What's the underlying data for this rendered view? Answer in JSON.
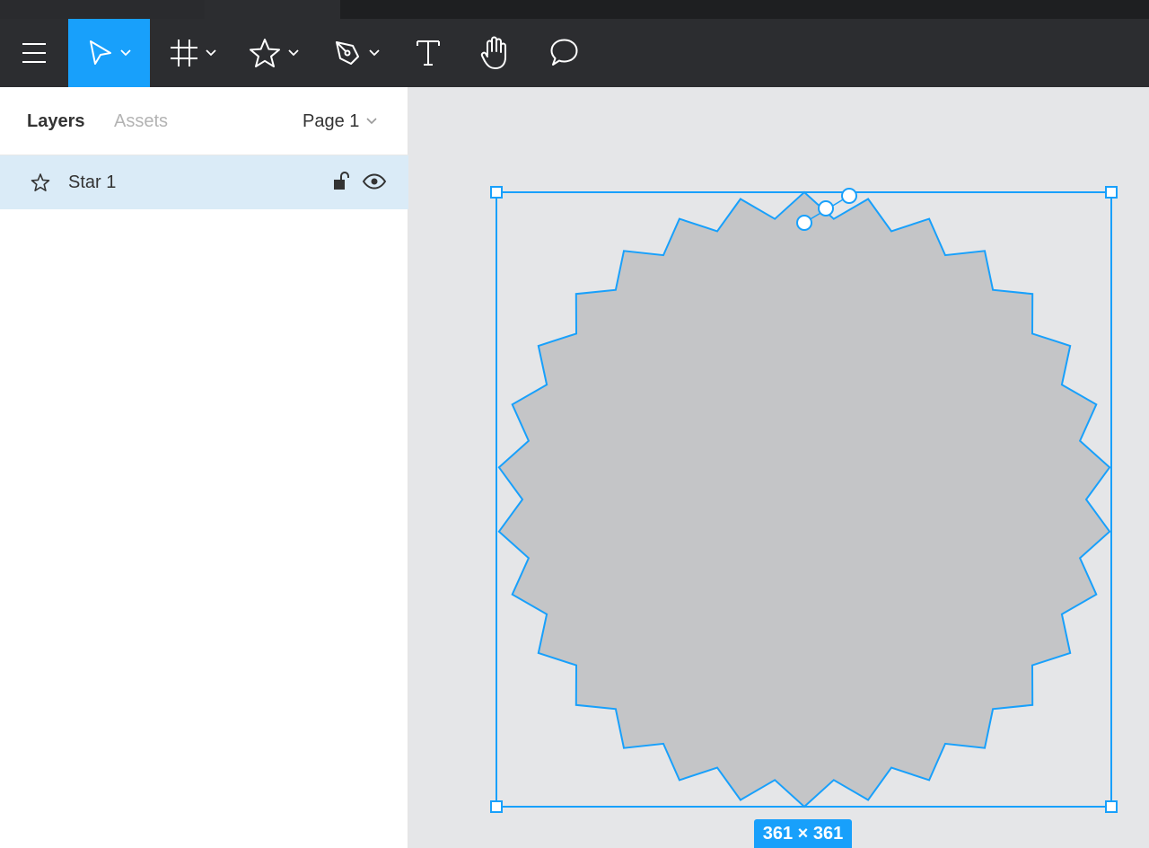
{
  "toolbar": {
    "tools": [
      {
        "name": "menu-icon"
      },
      {
        "name": "move-tool-icon",
        "active": true
      },
      {
        "name": "frame-tool-icon"
      },
      {
        "name": "star-tool-icon"
      },
      {
        "name": "pen-tool-icon"
      },
      {
        "name": "text-tool-icon"
      },
      {
        "name": "hand-tool-icon"
      },
      {
        "name": "comment-tool-icon"
      }
    ],
    "active_color": "#18a0fb"
  },
  "sidebar": {
    "tabs": [
      {
        "label": "Layers",
        "active": true
      },
      {
        "label": "Assets",
        "active": false
      }
    ],
    "page": "Page 1",
    "layers": [
      {
        "name": "Star 1",
        "icon": "star-icon",
        "selected": true,
        "locked": false,
        "visible": true
      }
    ]
  },
  "canvas": {
    "selection_size": "361 × 361",
    "shape": {
      "type": "star",
      "points": 30,
      "fill": "#c4c5c7",
      "stroke": "#18a0fb"
    }
  }
}
